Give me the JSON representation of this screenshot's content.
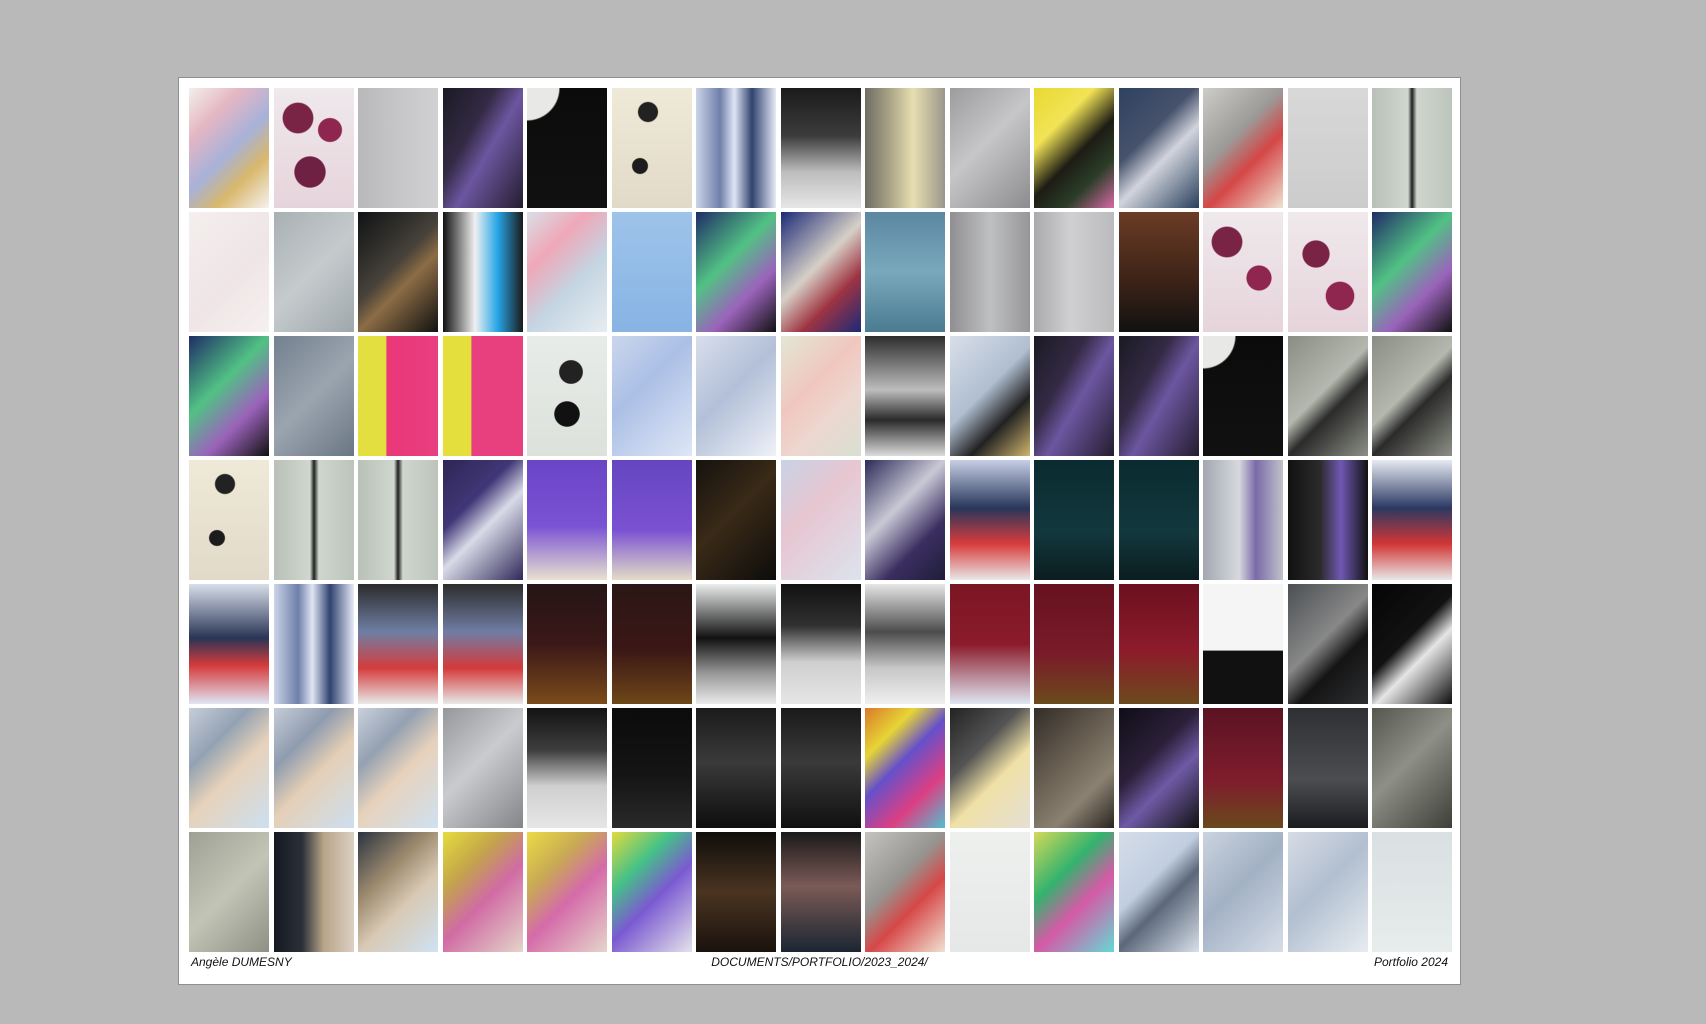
{
  "page": {
    "author": "Angèle DUMESNY",
    "path": "DOCUMENTS/PORTFOLIO/2023_2024/",
    "label": "Portfolio 2024"
  },
  "gallery": {
    "rows": [
      [
        {
          "bg": "linear-gradient(135deg,#f3efe8 0%,#e4b7c4 26%,#a7b2d9 52%,#d9b86d 73%,#f5f2ef 100%)"
        },
        {
          "bg": "radial-gradient(circle at 30% 25%,#7a2445 0 14%,transparent 15%),radial-gradient(circle at 70% 35%,#8f2650 0 12%,transparent 13%),radial-gradient(circle at 45% 70%,#6e2142 0 16%,transparent 17%),linear-gradient(180deg,#efe9ec 0%,#e6d4db 100%)"
        },
        {
          "bg": "linear-gradient(90deg,#b9b8ba 0%,#c5c4c6 45%,#d1d0d2 100%)"
        },
        {
          "bg": "linear-gradient(120deg,#1b1a24 0%,#332a44 35%,#6c56a0 55%,#241d2f 100%)"
        },
        {
          "bg": "radial-gradient(circle at 0% 0%,#e8e8e6 0 22%,transparent 23%),linear-gradient(180deg,#0b0b0b 0%,#111 100%)"
        },
        {
          "bg": "radial-gradient(circle at 45% 20%,#222 0 9%,transparent 10%),radial-gradient(circle at 35% 65%,#1c1c1c 0 8%,transparent 9%),linear-gradient(180deg,#efe9d8 0%,#e2dac8 100%)"
        },
        {
          "bg": "linear-gradient(90deg,#cbd4e7 0%,#6f7faa 30%,#dfe5f4 48%,#30436f 70%,#e6ebf7 100%)"
        },
        {
          "bg": "linear-gradient(180deg,#1b1b1b 0%,#3c3c3c 40%,#bdbdbd 70%,#e6e6e6 100%)"
        },
        {
          "bg": "linear-gradient(90deg,#6f6d64 0%,#b2ac8b 35%,#e7dfb1 60%,#9b968b 100%)"
        },
        {
          "bg": "linear-gradient(135deg,#9c9c9e 0%,#c6c6c8 45%,#8c8c8f 100%)"
        },
        {
          "bg": "linear-gradient(135deg,#e8d932 0%,#f2e356 30%,#1d1c14 55%,#2b3d28 75%,#d66aa5 100%)"
        },
        {
          "bg": "linear-gradient(135deg,#2e425f 0%,#47526c 38%,#d1d4dd 58%,#293f5b 100%)"
        },
        {
          "bg": "linear-gradient(135deg,#cdccc8 0%,#9b9a97 40%,#d44747 62%,#efe2d2 100%)"
        },
        {
          "bg": "linear-gradient(180deg,#d8d8d8 0%,#cdcccc 100%)"
        },
        {
          "bg": "linear-gradient(90deg,#b8c0b7 0%,#d0d7cf 45%,#1d1f1d 50%,#cfd6ce 56%,#bcc4bb 100%)"
        }
      ],
      [
        {
          "bg": "linear-gradient(135deg,#f4efee 0%,#efe5e6 55%,#f6f0ef 100%)"
        },
        {
          "bg": "linear-gradient(135deg,#a9b0b3 0%,#c5cbcd 50%,#9ea7ab 100%)"
        },
        {
          "bg": "linear-gradient(135deg,#0f1215 0%,#47423a 45%,#8c6c45 60%,#111 100%)"
        },
        {
          "bg": "linear-gradient(90deg,#111 0%,#f0f0f0 40%,#27a6e8 68%,#1a1a1a 100%)"
        },
        {
          "bg": "linear-gradient(135deg,#d8dfe5 0%,#efa7b8 30%,#c4d5e2 60%,#e7edf1 100%)"
        },
        {
          "bg": "linear-gradient(180deg,#9ec3ea 0%,#87b4e4 100%)"
        },
        {
          "bg": "linear-gradient(135deg,#1f2c66 0%,#51c184 40%,#9b63bb 68%,#111 100%)"
        },
        {
          "bg": "linear-gradient(135deg,#1c2a78 0%,#d6d0c7 45%,#9e3442 70%,#1c2a78 100%)"
        },
        {
          "bg": "linear-gradient(180deg,#5b87a1 0%,#79a8bc 50%,#4b7b91 100%)"
        },
        {
          "bg": "linear-gradient(90deg,#8f8f91 0%,#bfc0c2 50%,#969699 100%)"
        },
        {
          "bg": "linear-gradient(90deg,#aaa9ab 0%,#d0cfd1 45%,#bbbbbd 100%)"
        },
        {
          "bg": "linear-gradient(180deg,#6b3c25 0%,#3f2418 55%,#111 100%)"
        },
        {
          "bg": "radial-gradient(circle at 30% 25%,#7a2445 0 14%,transparent 15%),radial-gradient(circle at 70% 55%,#8f2650 0 14%,transparent 15%),linear-gradient(180deg,#efe9ec 0%,#e6d4db 100%)"
        },
        {
          "bg": "radial-gradient(circle at 35% 35%,#7a2445 0 14%,transparent 15%),radial-gradient(circle at 65% 70%,#8f2650 0 14%,transparent 15%),linear-gradient(180deg,#efe9ec 0%,#e6d4db 100%)"
        },
        {
          "bg": "linear-gradient(135deg,#1f2c66 0%,#51c184 40%,#9b63bb 68%,#111 100%)"
        }
      ],
      [
        {
          "bg": "linear-gradient(135deg,#1f2c66 0%,#51c184 40%,#9b63bb 68%,#111 100%)"
        },
        {
          "bg": "linear-gradient(135deg,#73808e 0%,#9ba5b0 50%,#6b7684 100%)"
        },
        {
          "bg": "linear-gradient(90deg,#e4df41 0%,#e4df41 35%,#ea3778 36%,#e83f7f 100%)"
        },
        {
          "bg": "linear-gradient(90deg,#e5df3e 0%,#e5df3e 35%,#e83f7f 36%,#e83f7f 100%)"
        },
        {
          "bg": "radial-gradient(circle at 55% 30%,#222 0 12%,transparent 13%),radial-gradient(circle at 50% 65%,#111 0 14%,transparent 15%),linear-gradient(180deg,#e8ece8 0%,#dce1dc 100%)"
        },
        {
          "bg": "linear-gradient(135deg,#cbd6ec 0%,#abc0e6 40%,#dfe6f5 100%)"
        },
        {
          "bg": "linear-gradient(135deg,#d8deeb 0%,#b3c0d9 45%,#eef1f7 100%)"
        },
        {
          "bg": "linear-gradient(135deg,#e2e6d6 0%,#f0c7be 40%,#edd7d0 65%,#d9dfd2 100%)"
        },
        {
          "bg": "linear-gradient(180deg,#2d2d2d 0%,#bdbdbd 45%,#2a2a2a 70%,#dbdbdb 100%)"
        },
        {
          "bg": "linear-gradient(135deg,#d8dfe8 0%,#b0bed1 45%,#222 70%,#d0b56d 100%)"
        },
        {
          "bg": "linear-gradient(120deg,#1b1a24 0%,#332a44 35%,#6c56a0 55%,#241d2f 100%)"
        },
        {
          "bg": "linear-gradient(120deg,#1b1a24 0%,#332a44 35%,#6c56a0 55%,#241d2f 100%)"
        },
        {
          "bg": "radial-gradient(circle at 0% 0%,#e8e8e6 0 22%,transparent 23%),linear-gradient(180deg,#0b0b0b 0%,#111 100%)"
        },
        {
          "bg": "linear-gradient(135deg,#8a8d84 0%,#b4b8ae 45%,#2b2b2b 60%,#8d9087 100%)"
        },
        {
          "bg": "linear-gradient(135deg,#8a8d84 0%,#b4b8ae 45%,#2b2b2b 60%,#8d9087 100%)"
        }
      ],
      [
        {
          "bg": "radial-gradient(circle at 45% 20%,#222 0 9%,transparent 10%),radial-gradient(circle at 35% 65%,#1c1c1c 0 8%,transparent 9%),linear-gradient(180deg,#efe9d8 0%,#e2dac8 100%)"
        },
        {
          "bg": "linear-gradient(90deg,#b8c0b7 0%,#d0d7cf 45%,#1d1f1d 50%,#cfd6ce 56%,#bcc4bb 100%)"
        },
        {
          "bg": "linear-gradient(90deg,#b8c0b7 0%,#d0d7cf 45%,#1d1f1d 50%,#cfd6ce 56%,#bcc4bb 100%)"
        },
        {
          "bg": "linear-gradient(135deg,#2d2655 0%,#413777 35%,#d9dbe8 55%,#2f2858 100%)"
        },
        {
          "bg": "linear-gradient(180deg,#6a45c6 0%,#7a52d4 55%,#e8e1cf 100%)"
        },
        {
          "bg": "linear-gradient(180deg,#6546c0 0%,#7a51d2 58%,#e3dcc7 100%)"
        },
        {
          "bg": "linear-gradient(135deg,#15120f 0%,#3a2a17 45%,#0d0c0b 100%)"
        },
        {
          "bg": "linear-gradient(135deg,#c8d3e6 0%,#e7c6d1 40%,#dce3ee 100%)"
        },
        {
          "bg": "linear-gradient(135deg,#2c2a58 0%,#c9c9d6 40%,#3b2e61 70%,#1e1e38 100%)"
        },
        {
          "bg": "linear-gradient(180deg,#c7cfe5 0%,#27365a 40%,#d93c3c 70%,#e8e8e8 100%)"
        },
        {
          "bg": "linear-gradient(180deg,#0a2b2f 0%,#12383d 60%,#0b1d20 100%)"
        },
        {
          "bg": "linear-gradient(180deg,#0a2b2f 0%,#12383d 60%,#0b1d20 100%)"
        },
        {
          "bg": "linear-gradient(90deg,#a3a7b2 0%,#d7d9de 45%,#7a6aa9 66%,#c0c2ca 100%)"
        },
        {
          "bg": "linear-gradient(90deg,#111 0%,#2b2b2b 40%,#6f58b4 66%,#111 100%)"
        },
        {
          "bg": "linear-gradient(180deg,#e6eaf2 0%,#2b3962 40%,#d23636 70%,#e7e7e7 100%)"
        }
      ],
      [
        {
          "bg": "linear-gradient(180deg,#d8dee9 0%,#293556 45%,#d53b3b 68%,#dfe5f2 100%)"
        },
        {
          "bg": "linear-gradient(90deg,#cbd4e7 0%,#6f7faa 30%,#dfe5f4 48%,#30436f 70%,#e6ebf7 100%)"
        },
        {
          "bg": "linear-gradient(180deg,#2b2b2b 0%,#6f7fa4 40%,#d43c3c 70%,#e9e9e9 100%)"
        },
        {
          "bg": "linear-gradient(180deg,#2d2d2d 0%,#707da4 40%,#d33a3a 70%,#e8e8e8 100%)"
        },
        {
          "bg": "linear-gradient(180deg,#251514 0%,#3b1818 50%,#7a4b1b 100%)"
        },
        {
          "bg": "linear-gradient(180deg,#2a1715 0%,#3b1716 55%,#6e4718 100%)"
        },
        {
          "bg": "linear-gradient(180deg,#eceeee 0%,#111 45%,#9a9a9a 75%,#eaeaea 100%)"
        },
        {
          "bg": "linear-gradient(180deg,#111 0%,#313131 35%,#cfcfcf 65%,#e6e6e6 100%)"
        },
        {
          "bg": "linear-gradient(180deg,#e6e6e6 0%,#4c4c4c 40%,#c7c7c7 70%,#efefef 100%)"
        },
        {
          "bg": "linear-gradient(180deg,#7a1623 0%,#8b1b2a 50%,#dfe6f2 100%)"
        },
        {
          "bg": "linear-gradient(180deg,#66111f 0%,#7a1b2a 58%,#6b4b1c 100%)"
        },
        {
          "bg": "linear-gradient(180deg,#6b1020 0%,#8d1b2b 55%,#6b4a1d 100%)"
        },
        {
          "bg": "linear-gradient(180deg,#f5f5f5 0%,#f5f5f5 55%,#111 56%,#111 100%)"
        },
        {
          "bg": "linear-gradient(135deg,#4b4f52 0%,#888 45%,#141414 65%,#2d2f31 100%)"
        },
        {
          "bg": "linear-gradient(135deg,#050505 0%,#121212 45%,#e5e5e5 62%,#0d0d0d 100%)"
        }
      ],
      [
        {
          "bg": "linear-gradient(135deg,#c7cdd8 0%,#93a2b3 30%,#e7d2ba 55%,#cbe0f1 100%)"
        },
        {
          "bg": "linear-gradient(135deg,#c6ccd7 0%,#8f9caf 30%,#e5cfb6 55%,#cddff0 100%)"
        },
        {
          "bg": "linear-gradient(135deg,#cad0db 0%,#94a1b2 30%,#e7d2bb 55%,#cfe1f1 100%)"
        },
        {
          "bg": "linear-gradient(135deg,#95979a 0%,#c9cbcf 45%,#838589 100%)"
        },
        {
          "bg": "linear-gradient(180deg,#131313 0%,#3d3d3d 35%,#cfcfcf 65%,#e6e6e6 100%)"
        },
        {
          "bg": "linear-gradient(180deg,#0b0b0b 0%,#141414 55%,#2a2a2a 100%)"
        },
        {
          "bg": "linear-gradient(180deg,#1b1b1b 0%,#3a3a3a 45%,#0d0d0d 100%)"
        },
        {
          "bg": "linear-gradient(180deg,#1a1a1a 0%,#3a3a3a 45%,#101010 100%)"
        },
        {
          "bg": "linear-gradient(135deg,#d97a2a 0%,#e7d536 25%,#6651c9 45%,#dc3f83 72%,#52c0cf 100%)"
        },
        {
          "bg": "linear-gradient(135deg,#232323 0%,#545454 35%,#f0e1a6 60%,#e5dfd6 100%)"
        },
        {
          "bg": "linear-gradient(135deg,#332d27 0%,#6d6356 45%,#8a8172 70%,#2b2520 100%)"
        },
        {
          "bg": "linear-gradient(135deg,#100d17 0%,#2b2039 40%,#6e5aa6 62%,#111 100%)"
        },
        {
          "bg": "linear-gradient(180deg,#5a1322 0%,#7f1c2d 60%,#6a491c 100%)"
        },
        {
          "bg": "linear-gradient(180deg,#2e3033 0%,#4b4d50 60%,#1b1d20 100%)"
        },
        {
          "bg": "linear-gradient(135deg,#55574f 0%,#8e9087 45%,#3d3f38 100%)"
        }
      ],
      [
        {
          "bg": "linear-gradient(135deg,#9ea093 0%,#c2c5b6 50%,#8e9084 100%)"
        },
        {
          "bg": "linear-gradient(90deg,#151a21 0%,#2a2f39 35%,#b8a488 62%,#dbd0c3 100%)"
        },
        {
          "bg": "linear-gradient(135deg,#2c3441 0%,#9c8a6e 35%,#d8c9b4 60%,#cfe2f3 100%)"
        },
        {
          "bg": "linear-gradient(135deg,#e6dc3d 0%,#c3a44b 30%,#d06ba4 55%,#e4d5c9 100%)"
        },
        {
          "bg": "linear-gradient(135deg,#ecdb45 0%,#c8aa54 30%,#d56ba9 55%,#e5d6ca 100%)"
        },
        {
          "bg": "linear-gradient(135deg,#e2db3e 0%,#45c187 30%,#7b5ad1 55%,#e4e3ea 100%)"
        },
        {
          "bg": "linear-gradient(180deg,#0f0d0b 0%,#4a3421 50%,#1a120d 100%)"
        },
        {
          "bg": "linear-gradient(180deg,#1a1a1a 0%,#7b5a56 45%,#1a2632 100%)"
        },
        {
          "bg": "linear-gradient(135deg,#c4c3bf 0%,#959490 40%,#d64848 62%,#efe2d2 100%)"
        },
        {
          "bg": "linear-gradient(180deg,#eef0ee 0%,#e5e8e7 100%)"
        },
        {
          "bg": "linear-gradient(135deg,#d4d957 0%,#33b36e 35%,#d55aa6 60%,#64d9d4 100%)"
        },
        {
          "bg": "linear-gradient(135deg,#d5dde8 0%,#c1cee0 40%,#5c687a 58%,#d8e0ea 100%)"
        },
        {
          "bg": "linear-gradient(135deg,#cbd3df 0%,#a2b1c4 45%,#d6dde7 100%)"
        },
        {
          "bg": "linear-gradient(135deg,#d6dce5 0%,#b2bfd0 45%,#e7ecf1 100%)"
        },
        {
          "bg": "linear-gradient(180deg,#d9e0e1 0%,#e7ecec 100%)"
        }
      ]
    ]
  }
}
